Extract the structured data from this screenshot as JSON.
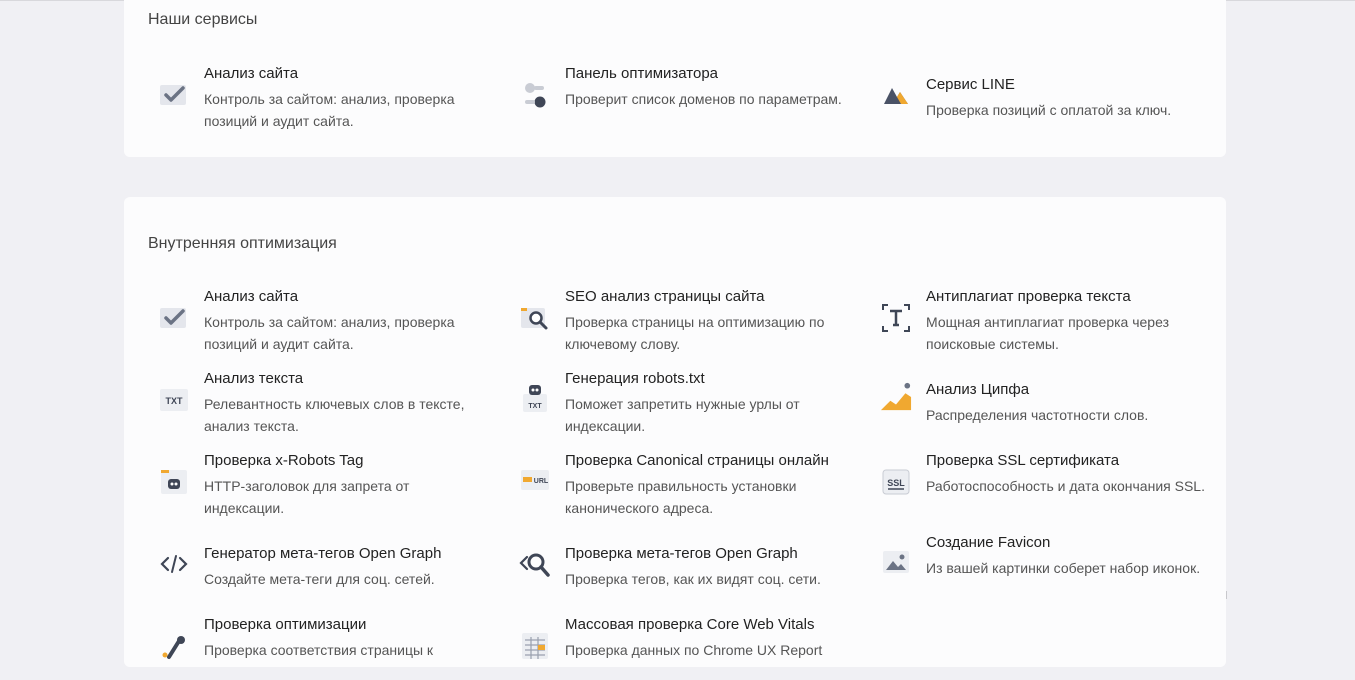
{
  "services": {
    "title": "Наши сервисы",
    "items": [
      {
        "title": "Анализ сайта",
        "desc": "Контроль за сайтом: анализ, проверка позиций и аудит сайта.",
        "icon": "checkmark-icon"
      },
      {
        "title": "Панель оптимизатора",
        "desc": "Проверит список доменов по параметрам.",
        "icon": "toggle-panel-icon"
      },
      {
        "title": "Сервис LINE",
        "desc": "Проверка позиций с оплатой за ключ.",
        "icon": "mountains-icon"
      }
    ]
  },
  "internal": {
    "title": "Внутренняя оптимизация",
    "items": [
      {
        "title": "Анализ сайта",
        "desc": "Контроль за сайтом: анализ, проверка позиций и аудит сайта.",
        "icon": "checkmark-icon"
      },
      {
        "title": "SEO анализ страницы сайта",
        "desc": "Проверка страницы на оптимизацию по ключевому слову.",
        "icon": "page-search-icon"
      },
      {
        "title": "Антиплагиат проверка текста",
        "desc": "Мощная антиплагиат проверка через поисковые системы.",
        "icon": "text-frame-icon"
      },
      {
        "title": "Анализ текста",
        "desc": "Релевантность ключевых слов в тексте, анализ текста.",
        "icon": "txt-icon",
        "icon_text": "TXT"
      },
      {
        "title": "Генерация robots.txt",
        "desc": "Поможет запретить нужные урлы от индексации.",
        "icon": "robot-icon",
        "icon_text": "TXT"
      },
      {
        "title": "Анализ Ципфа",
        "desc": "Распределения частотности слов.",
        "icon": "area-chart-icon"
      },
      {
        "title": "Проверка x-Robots Tag",
        "desc": "HTTP-заголовок для запрета от индексации.",
        "icon": "robots-tag-icon"
      },
      {
        "title": "Проверка Canonical страницы онлайн",
        "desc": "Проверьте правильность установки канонического адреса.",
        "icon": "url-icon",
        "icon_text": "URL"
      },
      {
        "title": "Проверка SSL сертификата",
        "desc": "Работоспособность и дата окончания SSL.",
        "icon": "ssl-icon",
        "icon_text": "SSL"
      },
      {
        "title": "Генератор мета-тегов Open Graph",
        "desc": "Создайте мета-теги для соц. сетей.",
        "icon": "code-icon"
      },
      {
        "title": "Проверка мета-тегов Open Graph",
        "desc": "Проверка тегов, как их видят соц. сети.",
        "icon": "tag-search-icon"
      },
      {
        "title": "Создание Favicon",
        "desc": "Из вашей картинки соберет набор иконок.",
        "icon": "image-icon"
      },
      {
        "title": "Проверка оптимизации",
        "desc": "Проверка соответствия страницы к",
        "icon": "rocket-icon"
      },
      {
        "title": "Массовая проверка Core Web Vitals",
        "desc": "Проверка данных по Chrome UX Report",
        "icon": "table-grid-icon"
      }
    ]
  },
  "colors": {
    "background": "#f0f0f4",
    "card": "#fcfcfd",
    "icon_gray": "#6b7384",
    "accent_orange": "#f0a830"
  }
}
